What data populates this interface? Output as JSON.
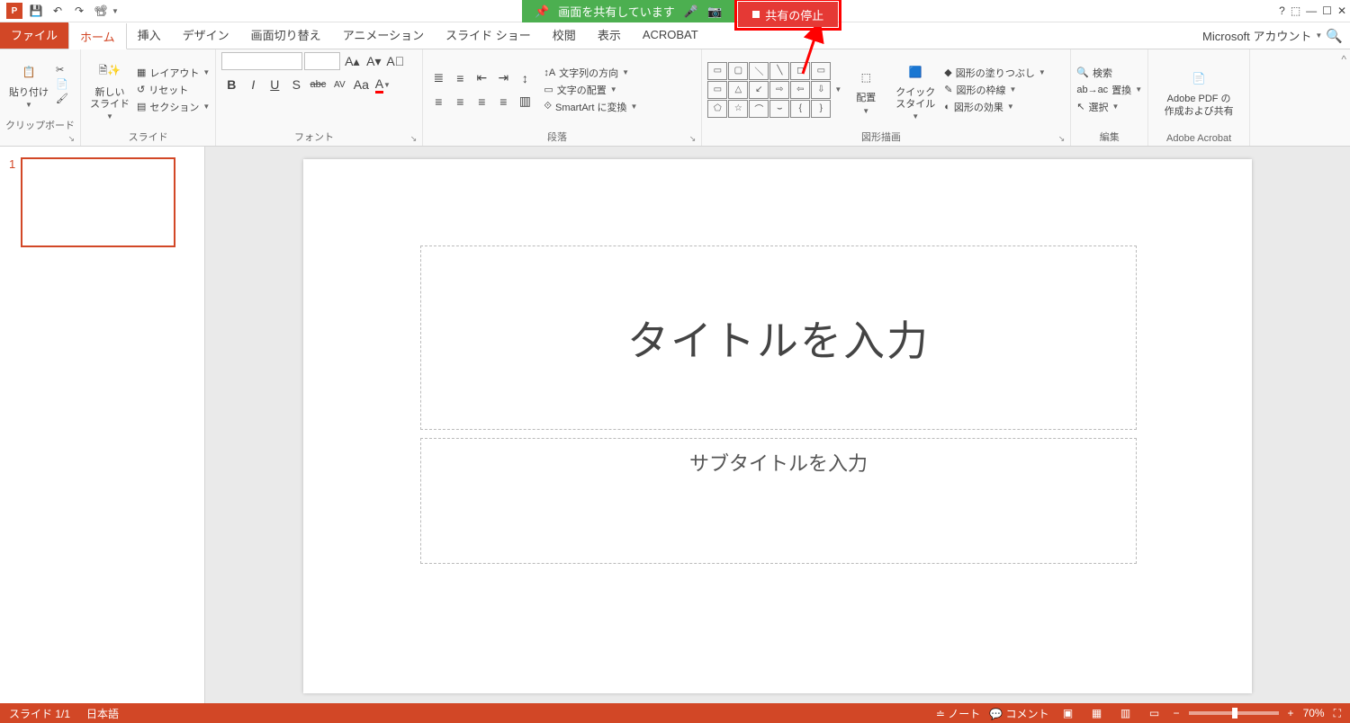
{
  "qat": {
    "save": "💾",
    "undo": "↶",
    "redo": "↷",
    "start": "▶"
  },
  "share": {
    "sharing_label": "画面を共有しています",
    "stop_label": "共有の停止"
  },
  "titlebar_right": {
    "help": "?",
    "account": "Microsoft アカウント"
  },
  "tabs": {
    "file": "ファイル",
    "home": "ホーム",
    "insert": "挿入",
    "design": "デザイン",
    "transitions": "画面切り替え",
    "animations": "アニメーション",
    "slideshow": "スライド ショー",
    "review": "校閲",
    "view": "表示",
    "acrobat": "ACROBAT"
  },
  "ribbon": {
    "clipboard": {
      "label": "クリップボード",
      "paste": "貼り付け"
    },
    "slides": {
      "label": "スライド",
      "new_slide": "新しい\nスライド",
      "layout": "レイアウト",
      "reset": "リセット",
      "section": "セクション"
    },
    "font": {
      "label": "フォント",
      "bold": "B",
      "italic": "I",
      "underline": "U",
      "shadow": "S",
      "strike": "abc",
      "spacing": "AV",
      "aa": "Aa",
      "color": "A",
      "grow": "A",
      "shrink": "A",
      "clear": "A"
    },
    "paragraph": {
      "label": "段落",
      "textdir": "文字列の方向",
      "align": "文字の配置",
      "smartart": "SmartArt に変換"
    },
    "drawing": {
      "label": "図形描画",
      "arrange": "配置",
      "quick": "クイック\nスタイル",
      "fill": "図形の塗りつぶし",
      "outline": "図形の枠線",
      "effects": "図形の効果"
    },
    "editing": {
      "label": "編集",
      "find": "検索",
      "replace": "置換",
      "select": "選択"
    },
    "acrobat": {
      "label": "Adobe Acrobat",
      "create": "Adobe PDF の\n作成および共有"
    }
  },
  "slide": {
    "title_placeholder": "タイトルを入力",
    "subtitle_placeholder": "サブタイトルを入力",
    "number": "1"
  },
  "status": {
    "slide_indicator": "スライド 1/1",
    "language": "日本語",
    "notes": "ノート",
    "comments": "コメント",
    "zoom": "70%"
  }
}
